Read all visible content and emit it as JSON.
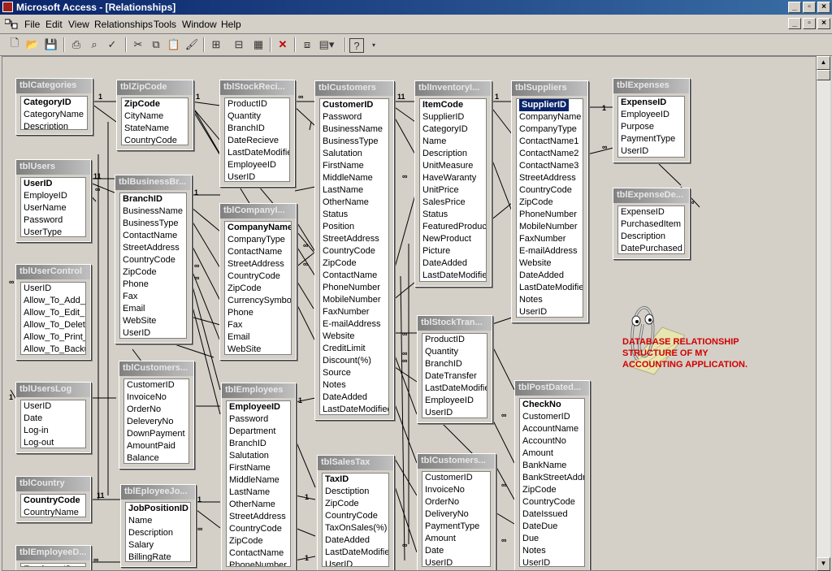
{
  "window": {
    "title": "Microsoft Access - [Relationships]",
    "controls": [
      "_",
      "▫",
      "×"
    ]
  },
  "menu": [
    "File",
    "Edit",
    "View",
    "Relationships",
    "Tools",
    "Window",
    "Help"
  ],
  "toolbar_icons": [
    "new-icon",
    "open-icon",
    "save-icon",
    "print-icon",
    "print-preview-icon",
    "spelling-icon",
    "cut-icon",
    "copy-icon",
    "paste-icon",
    "format-painter-icon",
    "show-table-icon",
    "show-direct-icon",
    "show-all-icon",
    "delete-icon",
    "relationships-icon",
    "new-object-icon",
    "help-icon"
  ],
  "annotation": [
    "DATABASE RELATIONSHIP",
    "STRUCTURE OF MY",
    "ACCOUNTING APPLICATION."
  ],
  "tables": [
    {
      "name": "tblCategories",
      "fields": [
        "CategoryID",
        "CategoryName",
        "Description"
      ],
      "pk": [
        0
      ]
    },
    {
      "name": "tblZipCode",
      "fields": [
        "ZipCode",
        "CityName",
        "StateName",
        "CountryCode"
      ],
      "pk": [
        0
      ]
    },
    {
      "name": "tblStockReci...",
      "fields": [
        "ProductID",
        "Quantity",
        "BranchID",
        "DateRecieve",
        "LastDateModified",
        "EmployeeID",
        "UserID"
      ],
      "pk": []
    },
    {
      "name": "tblCustomers",
      "fields": [
        "CustomerID",
        "Password",
        "BusinessName",
        "BusinessType",
        "Salutation",
        "FirstName",
        "MiddleName",
        "LastName",
        "OtherName",
        "Status",
        "Position",
        "StreetAddress",
        "CountryCode",
        "ZipCode",
        "ContactName",
        "PhoneNumber",
        "MobileNumber",
        "FaxNumber",
        "E-mailAddress",
        "Website",
        "CreditLimit",
        "Discount(%)",
        "Source",
        "Notes",
        "DateAdded",
        "LastDateModified"
      ],
      "pk": [
        0
      ]
    },
    {
      "name": "tblInventoryI...",
      "fields": [
        "ItemCode",
        "SupplierID",
        "CategoryID",
        "Name",
        "Description",
        "UnitMeasure",
        "HaveWaranty",
        "UnitPrice",
        "SalesPrice",
        "Status",
        "FeaturedProduct",
        "NewProduct",
        "Picture",
        "DateAdded",
        "LastDateModified"
      ],
      "pk": [
        0
      ]
    },
    {
      "name": "tblSuppliers",
      "fields": [
        "SupplierID",
        "CompanyName",
        "CompanyType",
        "ContactName1",
        "ContactName2",
        "ContactName3",
        "StreetAddress",
        "CountryCode",
        "ZipCode",
        "PhoneNumber",
        "MobileNumber",
        "FaxNumber",
        "E-mailAddress",
        "Website",
        "DateAdded",
        "LastDateModified",
        "Notes",
        "UserID"
      ],
      "pk": [
        0
      ],
      "sel": 0
    },
    {
      "name": "tblExpenses",
      "fields": [
        "ExpenseID",
        "EmployeeID",
        "Purpose",
        "PaymentType",
        "UserID"
      ],
      "pk": [
        0
      ]
    },
    {
      "name": "tblExpenseDe...",
      "fields": [
        "ExpenseID",
        "PurchasedItem",
        "Description",
        "DatePurchased"
      ],
      "pk": []
    },
    {
      "name": "tblUsers",
      "fields": [
        "UserID",
        "EmployeID",
        "UserName",
        "Password",
        "UserType"
      ],
      "pk": [
        0
      ]
    },
    {
      "name": "tblBusinessBr...",
      "fields": [
        "BranchID",
        "BusinessName",
        "BusinessType",
        "ContactName",
        "StreetAddress",
        "CountryCode",
        "ZipCode",
        "Phone",
        "Fax",
        "Email",
        "WebSite",
        "UserID"
      ],
      "pk": [
        0
      ]
    },
    {
      "name": "tblCompanyI...",
      "fields": [
        "CompanyName",
        "CompanyType",
        "ContactName",
        "StreetAddress",
        "CountryCode",
        "ZipCode",
        "CurrencySymbol",
        "Phone",
        "Fax",
        "Email",
        "WebSite"
      ],
      "pk": [
        0
      ]
    },
    {
      "name": "tblUserControl",
      "fields": [
        "UserID",
        "Allow_To_Add_R",
        "Allow_To_Edit_R",
        "Allow_To_Delete",
        "Allow_To_Print_F",
        "Allow_To_Backup"
      ],
      "pk": []
    },
    {
      "name": "tblStockTran...",
      "fields": [
        "ProductID",
        "Quantity",
        "BranchID",
        "DateTransfer",
        "LastDateModified",
        "EmployeeID",
        "UserID"
      ],
      "pk": []
    },
    {
      "name": "tblUsersLog",
      "fields": [
        "UserID",
        "Date",
        "Log-in",
        "Log-out"
      ],
      "pk": []
    },
    {
      "name": "tblCustomers...",
      "fields": [
        "CustomerID",
        "InvoiceNo",
        "OrderNo",
        "DeleveryNo",
        "DownPayment",
        "AmountPaid",
        "Balance"
      ],
      "pk": []
    },
    {
      "name": "tblEmployees",
      "fields": [
        "EmployeeID",
        "Password",
        "Department",
        "BranchID",
        "Salutation",
        "FirstName",
        "MiddleName",
        "LastName",
        "OtherName",
        "StreetAddress",
        "CountryCode",
        "ZipCode",
        "ContactName",
        "PhoneNumber"
      ],
      "pk": [
        0
      ]
    },
    {
      "name": "tblPostDated...",
      "fields": [
        "CheckNo",
        "CustomerID",
        "AccountName",
        "AccountNo",
        "Amount",
        "BankName",
        "BankStreetAddre",
        "ZipCode",
        "CountryCode",
        "DateIssued",
        "DateDue",
        "Due",
        "Notes",
        "UserID"
      ],
      "pk": [
        0
      ]
    },
    {
      "name": "tblCountry",
      "fields": [
        "CountryCode",
        "CountryName"
      ],
      "pk": [
        0
      ]
    },
    {
      "name": "tblEployeeJo...",
      "fields": [
        "JobPositionID",
        "Name",
        "Description",
        "Salary",
        "BillingRate"
      ],
      "pk": [
        0
      ]
    },
    {
      "name": "tblSalesTax",
      "fields": [
        "TaxID",
        "Desctiption",
        "ZipCode",
        "CountryCode",
        "TaxOnSales(%)",
        "DateAdded",
        "LastDateModified",
        "UserID"
      ],
      "pk": [
        0
      ]
    },
    {
      "name": "tblCustomers...",
      "fields": [
        "CustomerID",
        "InvoiceNo",
        "OrderNo",
        "DeliveryNo",
        "PaymentType",
        "Amount",
        "Date",
        "UserID"
      ],
      "pk": []
    },
    {
      "name": "tblEmployeeD...",
      "fields": [
        "EmployeeID"
      ],
      "pk": []
    }
  ]
}
